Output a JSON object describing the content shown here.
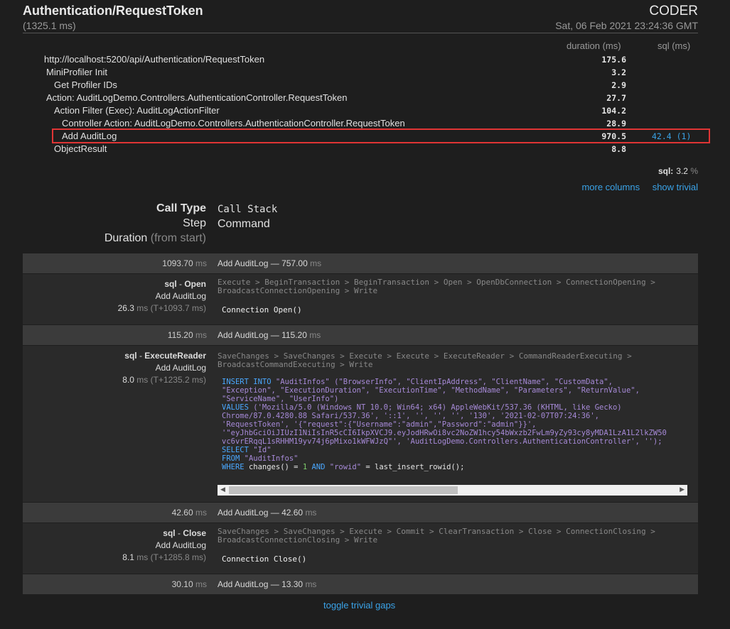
{
  "header": {
    "title": "Authentication/RequestToken",
    "total_duration": "(1325.1 ms)",
    "machine": "CODER",
    "date": "Sat, 06 Feb 2021 23:24:36 GMT"
  },
  "columns": {
    "duration": "duration (ms)",
    "sql": "sql (ms)"
  },
  "timings": [
    {
      "label": "http://localhost:5200/api/Authentication/RequestToken",
      "duration": "175.6",
      "sql": ""
    },
    {
      "label": "MiniProfiler Init",
      "duration": "3.2",
      "sql": ""
    },
    {
      "label": "Get Profiler IDs",
      "duration": "2.9",
      "sql": ""
    },
    {
      "label": "Action: AuditLogDemo.Controllers.AuthenticationController.RequestToken",
      "duration": "27.7",
      "sql": ""
    },
    {
      "label": "Action Filter (Exec): AuditLogActionFilter",
      "duration": "104.2",
      "sql": ""
    },
    {
      "label": "Controller Action: AuditLogDemo.Controllers.AuthenticationController.RequestToken",
      "duration": "28.9",
      "sql": ""
    },
    {
      "label": "Add AuditLog",
      "duration": "970.5",
      "sql": "42.4 (1)"
    },
    {
      "label": "ObjectResult",
      "duration": "8.8",
      "sql": ""
    }
  ],
  "summary": {
    "sql_label": "sql:",
    "sql_pct": "3.2",
    "pct_sign": "%"
  },
  "links": {
    "more_columns": "more columns",
    "show_trivial": "show trivial",
    "toggle_gaps": "toggle trivial gaps"
  },
  "legend": {
    "call_type": "Call Type",
    "step": "Step",
    "duration": "Duration",
    "from_start": "(from start)",
    "call_stack": "Call Stack",
    "command": "Command"
  },
  "gaps": [
    {
      "ms": "1093.70",
      "unit": "ms",
      "name": "Add AuditLog — 757.00",
      "name_unit": "ms"
    },
    {
      "ms": "115.20",
      "unit": "ms",
      "name": "Add AuditLog — 115.20",
      "name_unit": "ms"
    },
    {
      "ms": "42.60",
      "unit": "ms",
      "name": "Add AuditLog — 42.60",
      "name_unit": "ms"
    },
    {
      "ms": "30.10",
      "unit": "ms",
      "name": "Add AuditLog — 13.30",
      "name_unit": "ms"
    }
  ],
  "sql_calls": [
    {
      "type": "sql",
      "op": "Open",
      "step": "Add AuditLog",
      "dur": "26.3",
      "from_start": "ms (T+1093.7 ms)",
      "stack": "Execute > BeginTransaction > BeginTransaction > Open > OpenDbConnection > ConnectionOpening > BroadcastConnectionOpening > Write",
      "command": "Connection Open()"
    },
    {
      "type": "sql",
      "op": "ExecuteReader",
      "step": "Add AuditLog",
      "dur": "8.0",
      "from_start": "ms (T+1235.2 ms)",
      "stack": "SaveChanges > SaveChanges > Execute > Execute > ExecuteReader > CommandReaderExecuting > BroadcastCommandExecuting > Write"
    },
    {
      "type": "sql",
      "op": "Close",
      "step": "Add AuditLog",
      "dur": "8.1",
      "from_start": "ms (T+1285.8 ms)",
      "stack": "SaveChanges > SaveChanges > Execute > Commit > ClearTransaction > Close > ConnectionClosing > BroadcastConnectionClosing > Write",
      "command": "Connection Close()"
    }
  ],
  "sql_text": {
    "l1_kw": "INSERT INTO",
    "l1_tbl": "\"AuditInfos\"",
    "l1_cols": "(\"BrowserInfo\", \"ClientIpAddress\", \"ClientName\", \"CustomData\",",
    "l2": "\"Exception\", \"ExecutionDuration\", \"ExecutionTime\", \"MethodName\", \"Parameters\", \"ReturnValue\",",
    "l3": "\"ServiceName\", \"UserInfo\")",
    "l4_kw": "VALUES",
    "l4": "('Mozilla/5.0 (Windows NT 10.0; Win64; x64) AppleWebKit/537.36 (KHTML, like Gecko)",
    "l5": "Chrome/87.0.4280.88 Safari/537.36', '::1', '', '', '', '130', '2021-02-07T07:24:36',",
    "l6": "'RequestToken', '{\"request\":{\"Username\":\"admin\",\"Password\":\"admin\"}}',",
    "l7": "'\"eyJhbGciOiJIUzI1NiIsInR5cCI6IkpXVCJ9.eyJodHRwOi8vc2NoZW1hcy54bWxzb2FwLm9yZy93cy8yMDA1LzA1L2lkZW50",
    "l8": "vc6vrERqqL1sRHHM19yv74j6pMixo1kWFWJzQ\"', 'AuditLogDemo.Controllers.AuthenticationController', '');",
    "l9_kw": "SELECT",
    "l9": "\"Id\"",
    "l10_kw": "FROM",
    "l10": "\"AuditInfos\"",
    "l11_kw": "WHERE",
    "l11a": "changes() =",
    "l11_num": "1",
    "l11_and": "AND",
    "l11_str": "\"rowid\"",
    "l11b": "= last_insert_rowid();"
  },
  "colors": {
    "accent": "#3aa3e8",
    "highlight": "#e03535",
    "background": "#1e1e1e"
  }
}
